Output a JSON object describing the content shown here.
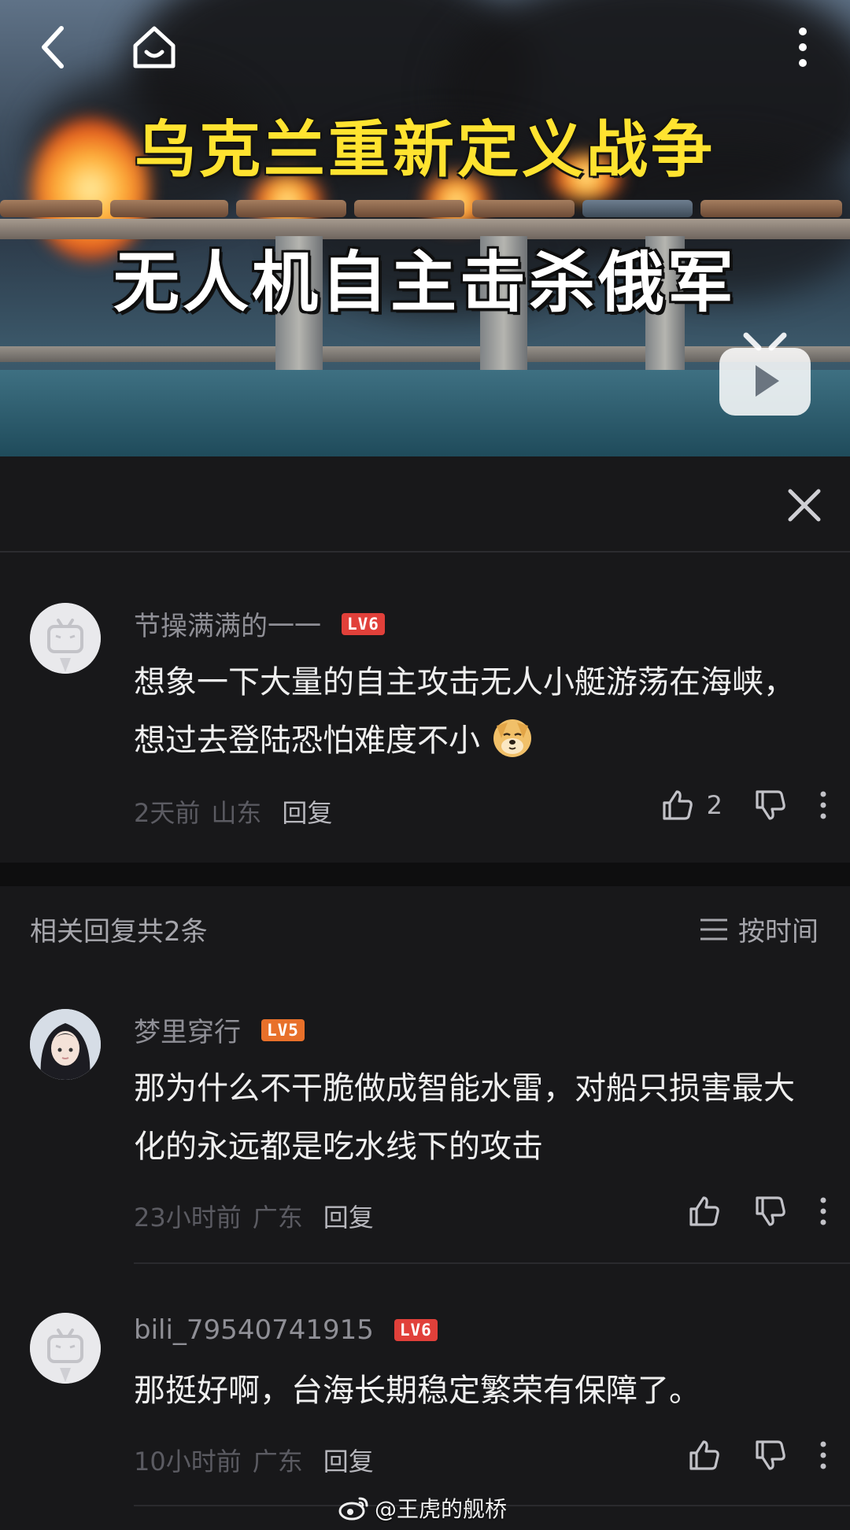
{
  "video": {
    "title_line1": "乌克兰重新定义战争",
    "title_line2": "无人机自主击杀俄军"
  },
  "main_comment": {
    "username": "节操满满的一一",
    "level": "LV6",
    "text": "想象一下大量的自主攻击无人小艇游荡在海峡，想过去登陆恐怕难度不小",
    "time": "2天前",
    "region": "山东",
    "reply_label": "回复",
    "like_count": "2"
  },
  "replies_section": {
    "title": "相关回复共2条",
    "sort_label": "按时间"
  },
  "replies": [
    {
      "username": "梦里穿行",
      "level": "LV5",
      "text": "那为什么不干脆做成智能水雷，对船只损害最大化的永远都是吃水线下的攻击",
      "time": "23小时前",
      "region": "广东",
      "reply_label": "回复"
    },
    {
      "username": "bili_79540741915",
      "level": "LV6",
      "text": "那挺好啊，台海长期稳定繁荣有保障了。",
      "time": "10小时前",
      "region": "广东",
      "reply_label": "回复"
    }
  ],
  "watermark": "@王虎的舰桥",
  "icons": {
    "back": "back-arrow-icon",
    "home": "home-icon",
    "more": "more-vertical-icon",
    "play": "bilibili-tv-icon",
    "close": "close-icon",
    "like": "thumbs-up-icon",
    "dislike": "thumbs-down-icon",
    "sort": "sort-lines-icon",
    "weibo": "weibo-icon"
  },
  "colors": {
    "background": "#18181a",
    "level6": "#e1403a",
    "level5": "#e8702a",
    "title_yellow": "#ffe330"
  }
}
